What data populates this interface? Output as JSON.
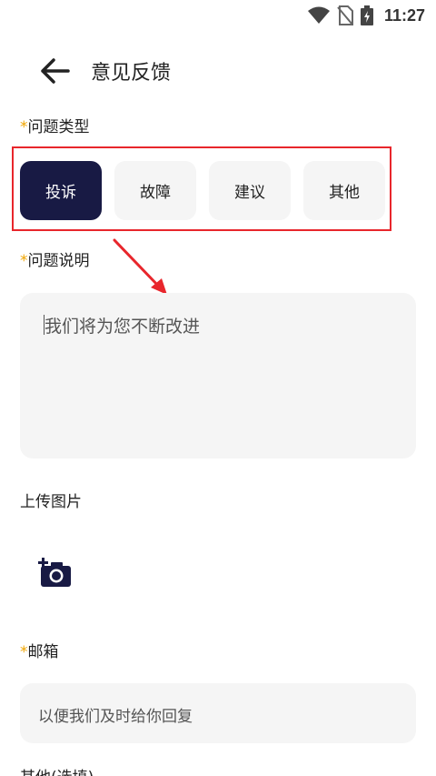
{
  "status_bar": {
    "time": "11:27",
    "icons": [
      "wifi-icon",
      "no-sim-icon",
      "battery-charging-icon"
    ]
  },
  "header": {
    "back_icon": "arrow-left-icon",
    "title": "意见反馈"
  },
  "required_mark": "*",
  "problem_type": {
    "label": "问题类型",
    "options": [
      "投诉",
      "故障",
      "建议",
      "其他"
    ],
    "selected": "投诉"
  },
  "problem_desc": {
    "label": "问题说明",
    "placeholder": "我们将为您不断改进"
  },
  "upload": {
    "label": "上传图片",
    "icon": "add-photo-camera-icon"
  },
  "email": {
    "label": "邮箱",
    "placeholder": "以便我们及时给你回复"
  },
  "other": {
    "label": "其他(选填)"
  },
  "colors": {
    "accent_dark": "#181a44",
    "required": "#f0a500",
    "highlight": "#e8262c",
    "field_bg": "#f5f5f5"
  }
}
